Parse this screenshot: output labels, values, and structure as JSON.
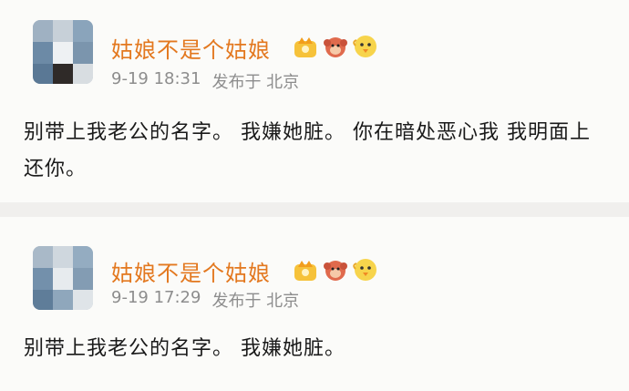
{
  "posts": [
    {
      "username": "姑娘不是个姑娘",
      "time": "9-19 18:31",
      "location": "发布于 北京",
      "text": "别带上我老公的名字。   我嫌她脏。 你在暗处恶心我  我明面上还你。",
      "badges": [
        "crown-badge-icon",
        "monkey-badge-icon",
        "chick-badge-icon"
      ]
    },
    {
      "username": "姑娘不是个姑娘",
      "time": "9-19 17:29",
      "location": "发布于 北京",
      "text": "别带上我老公的名字。  我嫌她脏。",
      "badges": [
        "crown-badge-icon",
        "monkey-badge-icon",
        "chick-badge-icon"
      ]
    }
  ]
}
